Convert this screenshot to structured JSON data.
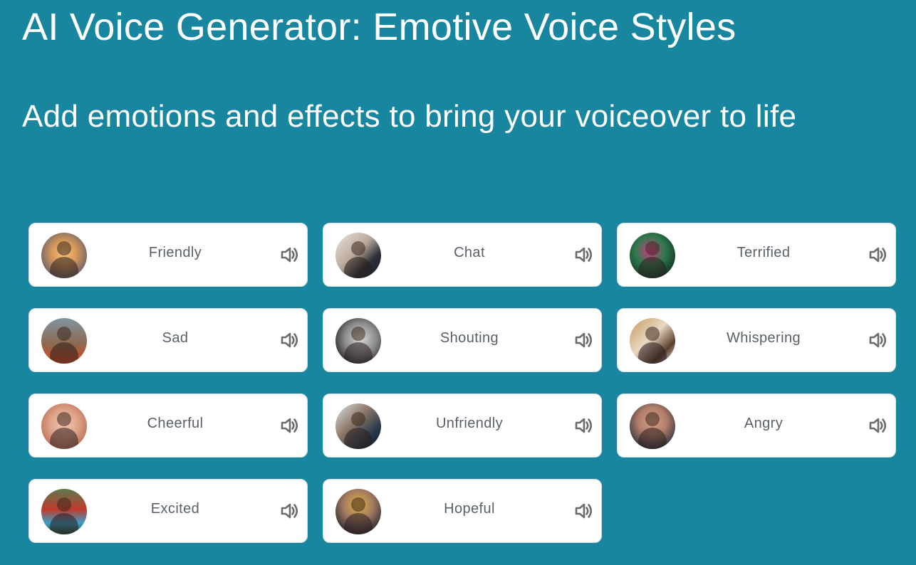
{
  "header": {
    "title": "AI Voice Generator: Emotive Voice Styles",
    "subtitle": "Add emotions and effects to bring your voiceover to life"
  },
  "colors": {
    "background": "#18869f",
    "card": "#ffffff",
    "label_text": "#5a6068",
    "icon": "#6b6b6b"
  },
  "voice_styles": [
    {
      "label": "Friendly",
      "icon": "speaker-icon",
      "avatar_bg": "radial-gradient(circle at 50% 45%, #f6c37a 0%, #d99a5a 35%, #7b6a66 70%, #efe3ea 100%)"
    },
    {
      "label": "Chat",
      "icon": "speaker-icon",
      "avatar_bg": "linear-gradient(135deg, #e9e3dc 0%, #b9a89a 45%, #2e3138 70%, #151a22 100%)"
    },
    {
      "label": "Terrified",
      "icon": "speaker-icon",
      "avatar_bg": "radial-gradient(circle at 45% 40%, #d63a8a 0%, #2f7a4c 40%, #0f2a1d 85%)"
    },
    {
      "label": "Sad",
      "icon": "speaker-icon",
      "avatar_bg": "linear-gradient(180deg, #7f96a0 0%, #8c6a52 55%, #c9502a 90%)"
    },
    {
      "label": "Shouting",
      "icon": "speaker-icon",
      "avatar_bg": "radial-gradient(circle at 55% 45%, #d9d9d9 0%, #8a8a8a 45%, #2a2a2a 80%, #e6e6e6 100%)"
    },
    {
      "label": "Whispering",
      "icon": "speaker-icon",
      "avatar_bg": "linear-gradient(135deg, #c69a5c 0%, #e8d8c4 45%, #5b3d2b 75%, #eeeeee 100%)"
    },
    {
      "label": "Cheerful",
      "icon": "speaker-icon",
      "avatar_bg": "radial-gradient(circle at 50% 45%, #f3c7b4 0%, #e0a58b 40%, #c47b63 70%, #f2ece8 100%)"
    },
    {
      "label": "Unfriendly",
      "icon": "speaker-icon",
      "avatar_bg": "linear-gradient(135deg, #dfe4e8 0%, #8f7a6a 40%, #24364a 75%, #111a26 100%)"
    },
    {
      "label": "Angry",
      "icon": "speaker-icon",
      "avatar_bg": "radial-gradient(circle at 50% 40%, #d7a08a 0%, #b27e6a 40%, #2e2f3d 80%, #e5e5e5 100%)"
    },
    {
      "label": "Excited",
      "icon": "speaker-icon",
      "avatar_bg": "linear-gradient(180deg, #5b7a4e 0%, #c0392b 45%, #3aa0c8 75%, #2d4a2f 100%)"
    },
    {
      "label": "Hopeful",
      "icon": "speaker-icon",
      "avatar_bg": "radial-gradient(circle at 50% 35%, #e3b23c 0%, #a27a62 40%, #3a3336 75%, #c08a76 100%)"
    }
  ]
}
